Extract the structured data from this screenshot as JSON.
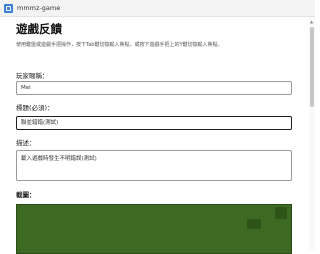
{
  "window": {
    "title": "mmmz-game"
  },
  "form": {
    "title": "遊戲反饋",
    "description": "使用鍵盤或遊戲手把操作，按下Tab鍵切換輸入焦點，或按下遊戲手把上的Y鍵切換輸入焦點。",
    "player_name": {
      "label": "玩家暱稱：",
      "value": "Mei"
    },
    "subject": {
      "label": "標題(必須)：",
      "value": "聯並錯錯(測試)"
    },
    "details": {
      "label": "描述：",
      "value": "載入遊戲時發生不明錯誤(測試)"
    },
    "screenshot": {
      "label": "截圖："
    }
  }
}
